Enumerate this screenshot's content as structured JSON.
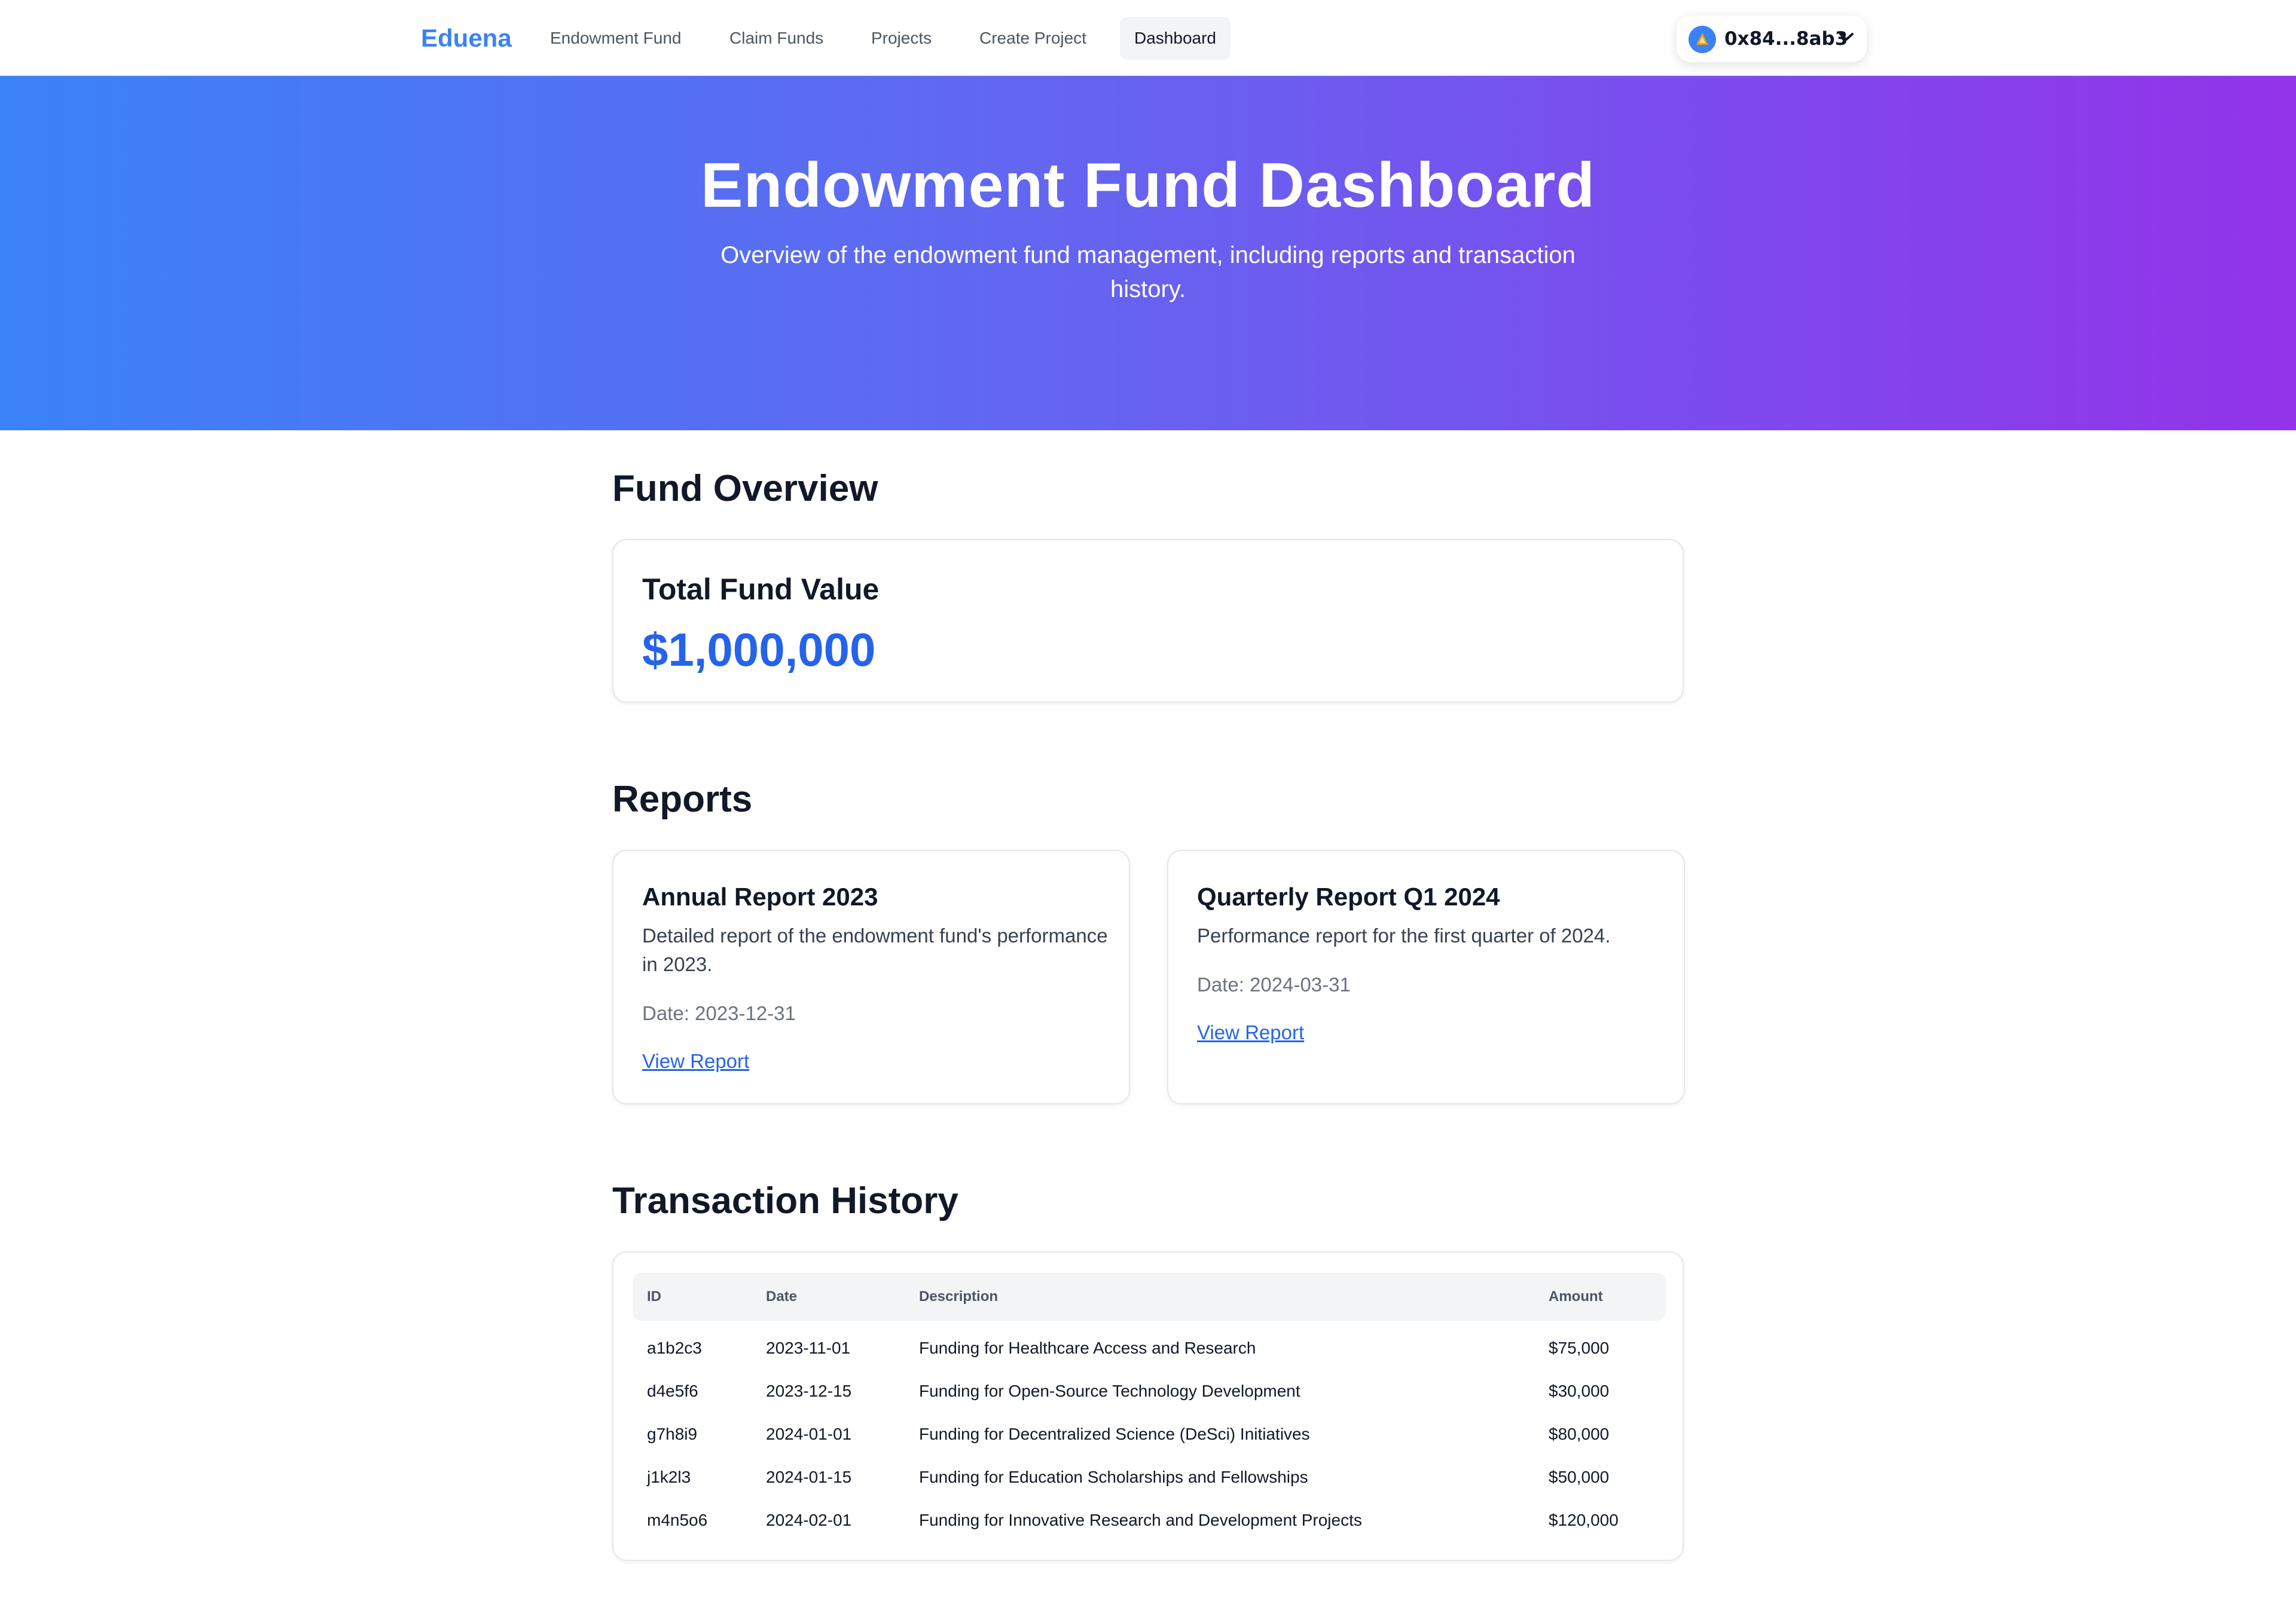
{
  "nav": {
    "brand": "Eduena",
    "links": [
      {
        "label": "Endowment Fund"
      },
      {
        "label": "Claim Funds"
      },
      {
        "label": "Projects"
      },
      {
        "label": "Create Project"
      },
      {
        "label": "Dashboard",
        "active": true
      }
    ],
    "wallet": {
      "address": "0x84...8ab3",
      "icon": "network-avatar-icon"
    }
  },
  "hero": {
    "title": "Endowment Fund Dashboard",
    "subtitle": "Overview of the endowment fund management, including reports and transaction history."
  },
  "overview": {
    "heading": "Fund Overview",
    "label": "Total Fund Value",
    "value": "$1,000,000"
  },
  "reports": {
    "heading": "Reports",
    "items": [
      {
        "title": "Annual Report 2023",
        "description": "Detailed report of the endowment fund's performance in 2023.",
        "date": "Date: 2023-12-31",
        "link": "View Report"
      },
      {
        "title": "Quarterly Report Q1 2024",
        "description": "Performance report for the first quarter of 2024.",
        "date": "Date: 2024-03-31",
        "link": "View Report"
      }
    ]
  },
  "transactions": {
    "heading": "Transaction History",
    "columns": [
      "ID",
      "Date",
      "Description",
      "Amount"
    ],
    "rows": [
      {
        "id": "a1b2c3",
        "date": "2023-11-01",
        "description": "Funding for Healthcare Access and Research",
        "amount": "$75,000"
      },
      {
        "id": "d4e5f6",
        "date": "2023-12-15",
        "description": "Funding for Open-Source Technology Development",
        "amount": "$30,000"
      },
      {
        "id": "g7h8i9",
        "date": "2024-01-01",
        "description": "Funding for Decentralized Science (DeSci) Initiatives",
        "amount": "$80,000"
      },
      {
        "id": "j1k2l3",
        "date": "2024-01-15",
        "description": "Funding for Education Scholarships and Fellowships",
        "amount": "$50,000"
      },
      {
        "id": "m4n5o6",
        "date": "2024-02-01",
        "description": "Funding for Innovative Research and Development Projects",
        "amount": "$120,000"
      }
    ]
  },
  "colors": {
    "brand": "#3b82f6",
    "value": "#2563eb",
    "gradient_start": "#3b82f6",
    "gradient_end": "#9333ea"
  }
}
